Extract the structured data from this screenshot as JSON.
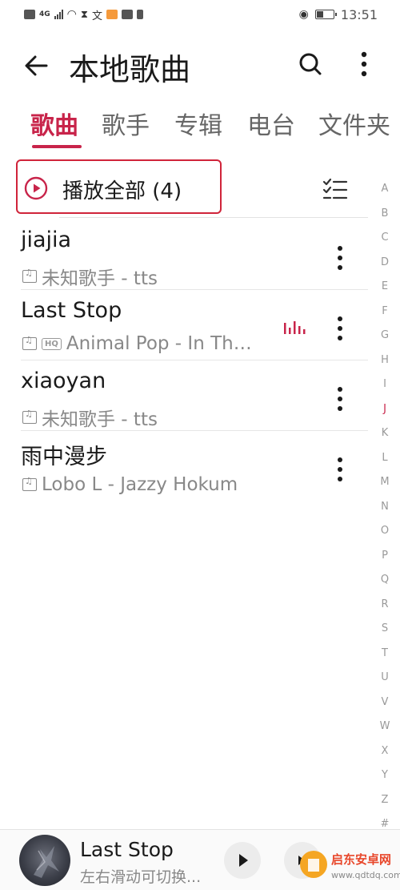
{
  "status_bar": {
    "time": "13:51",
    "network": "4G"
  },
  "header": {
    "title": "本地歌曲"
  },
  "tabs": [
    {
      "label": "歌曲",
      "active": true
    },
    {
      "label": "歌手",
      "active": false
    },
    {
      "label": "专辑",
      "active": false
    },
    {
      "label": "电台",
      "active": false
    },
    {
      "label": "文件夹",
      "active": false
    }
  ],
  "play_all": {
    "label": "播放全部",
    "count": "(4)"
  },
  "songs": [
    {
      "title": "jiajia",
      "subtitle": "未知歌手 - tts",
      "hq": false,
      "playing": false
    },
    {
      "title": "Last Stop",
      "subtitle": "Animal Pop - In Th…",
      "hq": true,
      "hq_label": "HQ",
      "playing": true
    },
    {
      "title": "xiaoyan",
      "subtitle": "未知歌手 - tts",
      "hq": false,
      "playing": false
    },
    {
      "title": "雨中漫步",
      "subtitle": "Lobo L - Jazzy Hokum",
      "hq": false,
      "playing": false
    }
  ],
  "alphabet": [
    "A",
    "B",
    "C",
    "D",
    "E",
    "F",
    "G",
    "H",
    "I",
    "J",
    "K",
    "L",
    "M",
    "N",
    "O",
    "P",
    "Q",
    "R",
    "S",
    "T",
    "U",
    "V",
    "W",
    "X",
    "Y",
    "Z",
    "#"
  ],
  "alphabet_active": "J",
  "player": {
    "title": "Last Stop",
    "subtitle": "左右滑动可切换..."
  },
  "watermark": {
    "brand": "启东安卓网",
    "url": "www.qdtdq.com"
  },
  "colors": {
    "accent": "#c8244a",
    "highlight_border": "#d0243a"
  }
}
